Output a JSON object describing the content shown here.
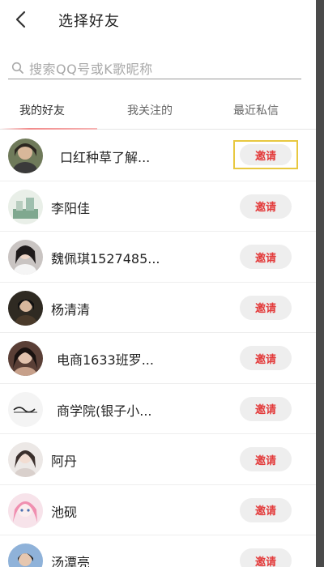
{
  "header": {
    "title": "选择好友"
  },
  "search": {
    "placeholder": "搜索QQ号或K歌昵称"
  },
  "tabs": [
    {
      "label": "我的好友",
      "active": true
    },
    {
      "label": "我关注的",
      "active": false
    },
    {
      "label": "最近私信",
      "active": false
    }
  ],
  "invite_label": "邀请",
  "colors": {
    "accent_red": "#e33b3b",
    "focus_outline": "#e8c840",
    "pill_bg": "#eeeeee"
  },
  "friends": [
    {
      "name": "口红种草了解..."
    },
    {
      "name": "李阳佳"
    },
    {
      "name": "魏佩琪1527485..."
    },
    {
      "name": "杨清清"
    },
    {
      "name": "电商1633班罗..."
    },
    {
      "name": "商学院(银子小..."
    },
    {
      "name": "阿丹"
    },
    {
      "name": "池砚"
    },
    {
      "name": "汤潭亮"
    }
  ]
}
